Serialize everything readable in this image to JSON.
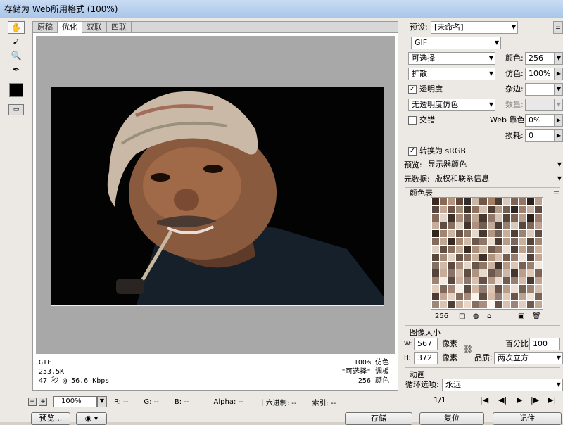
{
  "window": {
    "title": "存储为 Web所用格式 (100%)"
  },
  "tools": [
    {
      "name": "hand-tool",
      "glyph": "✋"
    },
    {
      "name": "slice-select-tool",
      "glyph": "➹"
    },
    {
      "name": "zoom-tool",
      "glyph": "🔍"
    },
    {
      "name": "eyedropper-tool",
      "glyph": "✒"
    }
  ],
  "view_tabs": [
    "原稿",
    "优化",
    "双联",
    "四联"
  ],
  "image_info": {
    "format": "GIF",
    "size": "253.5K",
    "time": "47 秒 @ 56.6 Kbps",
    "dither": "100% 仿色",
    "palette": "\"可选择\" 调板",
    "colors": "256 颜色"
  },
  "status": {
    "zoom": "100%",
    "r": "R: --",
    "g": "G: --",
    "b": "B: --",
    "alpha": "Alpha: --",
    "hex": "十六进制: --",
    "index": "索引: --"
  },
  "bottom_buttons": {
    "preview": "预览...",
    "save": "存储",
    "reset": "复位",
    "remember": "记住"
  },
  "settings": {
    "preset_label": "预设:",
    "preset_value": "[未命名]",
    "format_value": "GIF",
    "reduction_value": "可选择",
    "colors_label": "颜色:",
    "colors_value": "256",
    "dither_value": "扩散",
    "dither_label": "仿色:",
    "dither_amount": "100%",
    "transparency_label": "透明度",
    "matte_label": "杂边:",
    "transparency_dither": "无透明度仿色",
    "amount_label": "数量:",
    "interlaced_label": "交错",
    "web_snap_label": "Web 靠色:",
    "web_snap_value": "0%",
    "lossy_label": "损耗:",
    "lossy_value": "0",
    "convert_srgb_label": "转换为 sRGB",
    "preview_label": "预览:",
    "preview_value": "显示器颜色",
    "metadata_label": "元数据:",
    "metadata_value": "版权和联系信息"
  },
  "color_table": {
    "title": "颜色表",
    "count": "256",
    "swatches": [
      "#3b2a22",
      "#8a6a55",
      "#b39582",
      "#5e4638",
      "#2e2d2b",
      "#c9b8a8",
      "#6f5648",
      "#a47f68",
      "#4a3b33",
      "#d8cbbe",
      "#7c6455",
      "#957563",
      "#2a211c",
      "#b8a08f",
      "#584740",
      "#c4a893",
      "#6b5447",
      "#a08a7a",
      "#3f332c",
      "#8f7160",
      "#d1c2b4",
      "#4d3d34",
      "#b29a88",
      "#735d50",
      "#2f2621",
      "#9c806d",
      "#c7b3a3",
      "#5a4a41",
      "#84695a",
      "#e0d5ca",
      "#3c302a",
      "#a68c79",
      "#6a5a50",
      "#bca592",
      "#463830",
      "#91786a",
      "#d4c5b7",
      "#554439",
      "#7a6254",
      "#b69e8c",
      "#2b221d",
      "#9a7d6b",
      "#c5ae9c",
      "#604e44",
      "#887060",
      "#ddd1c5",
      "#41352e",
      "#ad917e",
      "#6e5e53",
      "#c0a998",
      "#4a3c34",
      "#96806f",
      "#d7c9bb",
      "#594840",
      "#7f6758",
      "#bba290",
      "#30271f",
      "#a28571",
      "#cbb5a4",
      "#675247",
      "#8b7464",
      "#e4d9ce",
      "#44382f",
      "#b39783",
      "#73625a",
      "#c6ae9b",
      "#4f4037",
      "#9b8371",
      "#dacdc0",
      "#5d4c42",
      "#836b5c",
      "#bfa795",
      "#342a23",
      "#a78a76",
      "#cfb9a8",
      "#6b574b",
      "#8f7767",
      "#e7ddd3",
      "#483b33",
      "#b89c88",
      "#77665d",
      "#c9b1a0",
      "#54443a",
      "#a08774",
      "#ddd0c4",
      "#614f45",
      "#876f60",
      "#c3ab99",
      "#382d26",
      "#ac8f7b",
      "#d3bdac",
      "#6f5a4e",
      "#937a6a",
      "#eae1d8",
      "#4c3f36",
      "#bea28d",
      "#7c6a61",
      "#cdb5a3",
      "#58473d",
      "#a48b78",
      "#e0d4c8",
      "#655348",
      "#8b7364",
      "#c7af9d",
      "#3c3029",
      "#b19480",
      "#d7c1b0",
      "#735e51",
      "#977d6d",
      "#ede5dc",
      "#504239",
      "#c3a792",
      "#816f66",
      "#d1b9a7",
      "#5c4a40",
      "#a98f7c",
      "#e3d7cc",
      "#69564b",
      "#8f7768",
      "#cbb3a1",
      "#40332c",
      "#b69985",
      "#dbc5b4",
      "#786254",
      "#9b8170",
      "#f0e8e0",
      "#54453c",
      "#c8ac97",
      "#86736a",
      "#d5bdab",
      "#604d43",
      "#ae9380",
      "#e6dacf",
      "#6d594e",
      "#937b6c",
      "#cfb7a5",
      "#44362f",
      "#bb9e8a",
      "#dfc9b8",
      "#7c6557",
      "#9f8473",
      "#f3ece4",
      "#58483f",
      "#cdb19c",
      "#8b776e",
      "#d9c1af",
      "#645046",
      "#b39884",
      "#e9ddd2",
      "#715c51",
      "#977f70",
      "#d3bba9",
      "#483932",
      "#c0a38f",
      "#e3cdbc",
      "#80685a",
      "#a38776",
      "#f6efe8",
      "#5c4b42",
      "#d2b6a1",
      "#907b72",
      "#ddc5b3",
      "#685349",
      "#b89d88",
      "#ece0d5",
      "#756054",
      "#9b8374",
      "#d7bfad",
      "#4c3c35",
      "#c5a894",
      "#e7d1c0",
      "#846b5d",
      "#a78a79",
      "#f9f3ec",
      "#604e45",
      "#d7bba6",
      "#957f76",
      "#e1c9b7",
      "#6c564c",
      "#bda28c",
      "#efe3d8",
      "#796357",
      "#9f8778",
      "#dbc3b1",
      "#503f38",
      "#caad99",
      "#ebd5c4",
      "#886e60",
      "#ab8d7c",
      "#fcf6f0",
      "#645148",
      "#dcc0ab",
      "#9a837a",
      "#e5cdbb",
      "#70594f",
      "#c2a790",
      "#f2e6db",
      "#7d665a",
      "#a38b7c",
      "#dfc7b5",
      "#54423b",
      "#cfb29e",
      "#efd9c8",
      "#8c7163",
      "#af907f",
      "#fff9f3",
      "#68544b",
      "#e1c5b0",
      "#9f877e",
      "#e9d1bf",
      "#745c52",
      "#c7ac94",
      "#f5e9de",
      "#81695d",
      "#a78f80",
      "#e3cbb9",
      "#58453e",
      "#d4b7a3",
      "#f3ddcc",
      "#907466",
      "#b39382",
      "#ffffff",
      "#6c574e",
      "#e6cab5",
      "#a48b82",
      "#edd5c3",
      "#785f55",
      "#ccb198",
      "#f8ece1",
      "#856c60",
      "#ab9384",
      "#e7cfbd",
      "#5c4841",
      "#d9bca8",
      "#f7e1d0",
      "#947769",
      "#b79685",
      "#101010",
      "#70594f",
      "#ebcfba",
      "#a98f86",
      "#f1d9c7",
      "#7c6258",
      "#d1b69c",
      "#fbefe4",
      "#896f63",
      "#af9788",
      "#ebd3c1",
      "#604b44"
    ]
  },
  "image_size": {
    "title": "图像大小",
    "w_label": "W:",
    "w_value": "567",
    "h_label": "H:",
    "h_value": "372",
    "unit": "像素",
    "percent_label": "百分比:",
    "percent_value": "100",
    "quality_label": "品质:",
    "quality_value": "两次立方"
  },
  "animation": {
    "title": "动画",
    "loop_label": "循环选项:",
    "loop_value": "永远",
    "frame_counter": "1/1"
  }
}
